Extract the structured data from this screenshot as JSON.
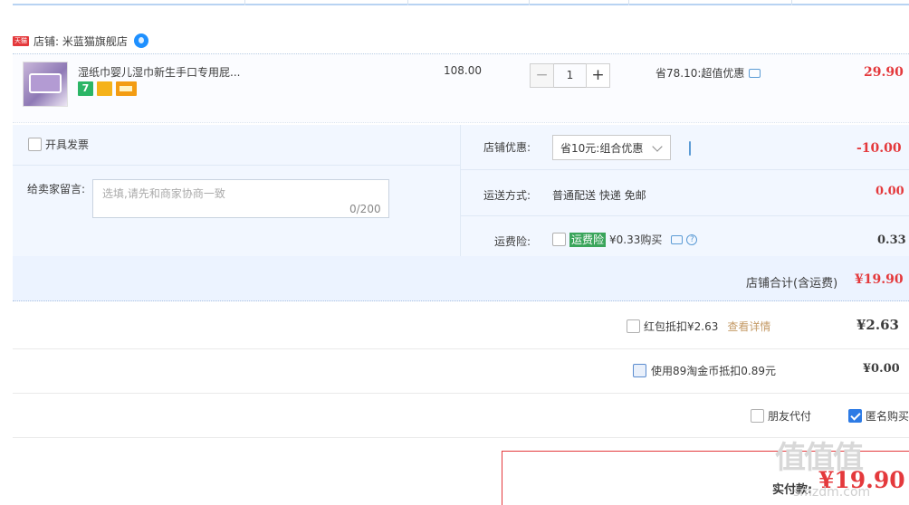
{
  "shop": {
    "badge": "天猫",
    "label": "店铺: 米蓝猫旗舰店"
  },
  "item": {
    "title": "湿纸巾婴儿湿巾新生手口专用屁...",
    "tag_1": "7",
    "unit_price": "108.00",
    "quantity": "1",
    "minus_label": "−",
    "plus_label": "+",
    "saving_text": "省78.10:超值优惠",
    "subtotal": "29.90"
  },
  "invoice": {
    "label": "开具发票"
  },
  "message": {
    "label": "给卖家留言:",
    "placeholder": "选填,请先和商家协商一致",
    "counter": "0/200"
  },
  "store_discount": {
    "label": "店铺优惠:",
    "selected": "省10元:组合优惠",
    "amount": "-10.00"
  },
  "shipping": {
    "label": "运送方式:",
    "value": "普通配送 快递 免邮",
    "amount": "0.00"
  },
  "insurance": {
    "label": "运费险:",
    "badge": "运费险",
    "text": "¥0.33购买",
    "amount": "0.33",
    "help": "?"
  },
  "store_total": {
    "label": "店铺合计(含运费)",
    "amount": "¥19.90"
  },
  "red_packet": {
    "label": "红包抵扣¥2.63",
    "link": "查看详情",
    "amount": "¥2.63"
  },
  "taojinbi": {
    "label": "使用89淘金币抵扣0.89元",
    "amount": "¥0.00"
  },
  "pay_options": {
    "friend": "朋友代付",
    "anonymous": "匿名购买"
  },
  "payment": {
    "label": "实付款:",
    "amount": "¥19.90"
  },
  "watermark": {
    "glyphs": "值值值",
    "url": "smzdm.com"
  },
  "colors": {
    "accent_red": "#e4393c",
    "link_blue": "#2d7be5",
    "panel_bg": "#f2f7ff"
  }
}
